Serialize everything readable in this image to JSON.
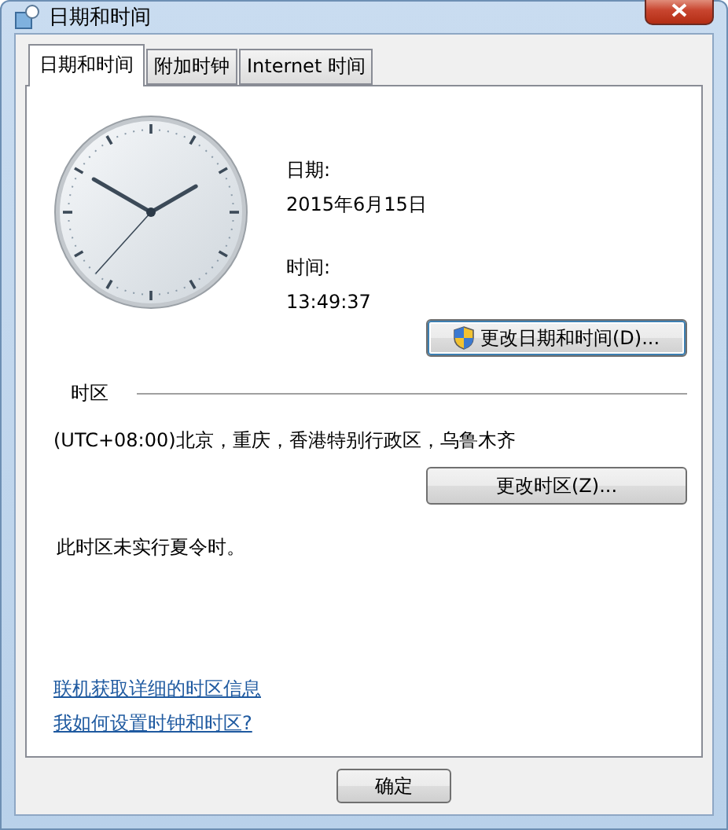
{
  "window": {
    "title": "日期和时间"
  },
  "tabs": [
    {
      "label": "日期和时间",
      "selected": true
    },
    {
      "label": "附加时钟",
      "selected": false
    },
    {
      "label": "Internet 时间",
      "selected": false
    }
  ],
  "date": {
    "label": "日期:",
    "value": "2015年6月15日"
  },
  "time": {
    "label": "时间:",
    "value": "13:49:37"
  },
  "change_datetime_button": "更改日期和时间(D)...",
  "timezone": {
    "heading": "时区",
    "value": "(UTC+08:00)北京，重庆，香港特别行政区，乌鲁木齐",
    "button": "更改时区(Z)...",
    "dst_note": "此时区未实行夏令时。"
  },
  "links": [
    "联机获取详细的时区信息",
    "我如何设置时钟和时区?"
  ],
  "buttons": [
    "确定"
  ]
}
